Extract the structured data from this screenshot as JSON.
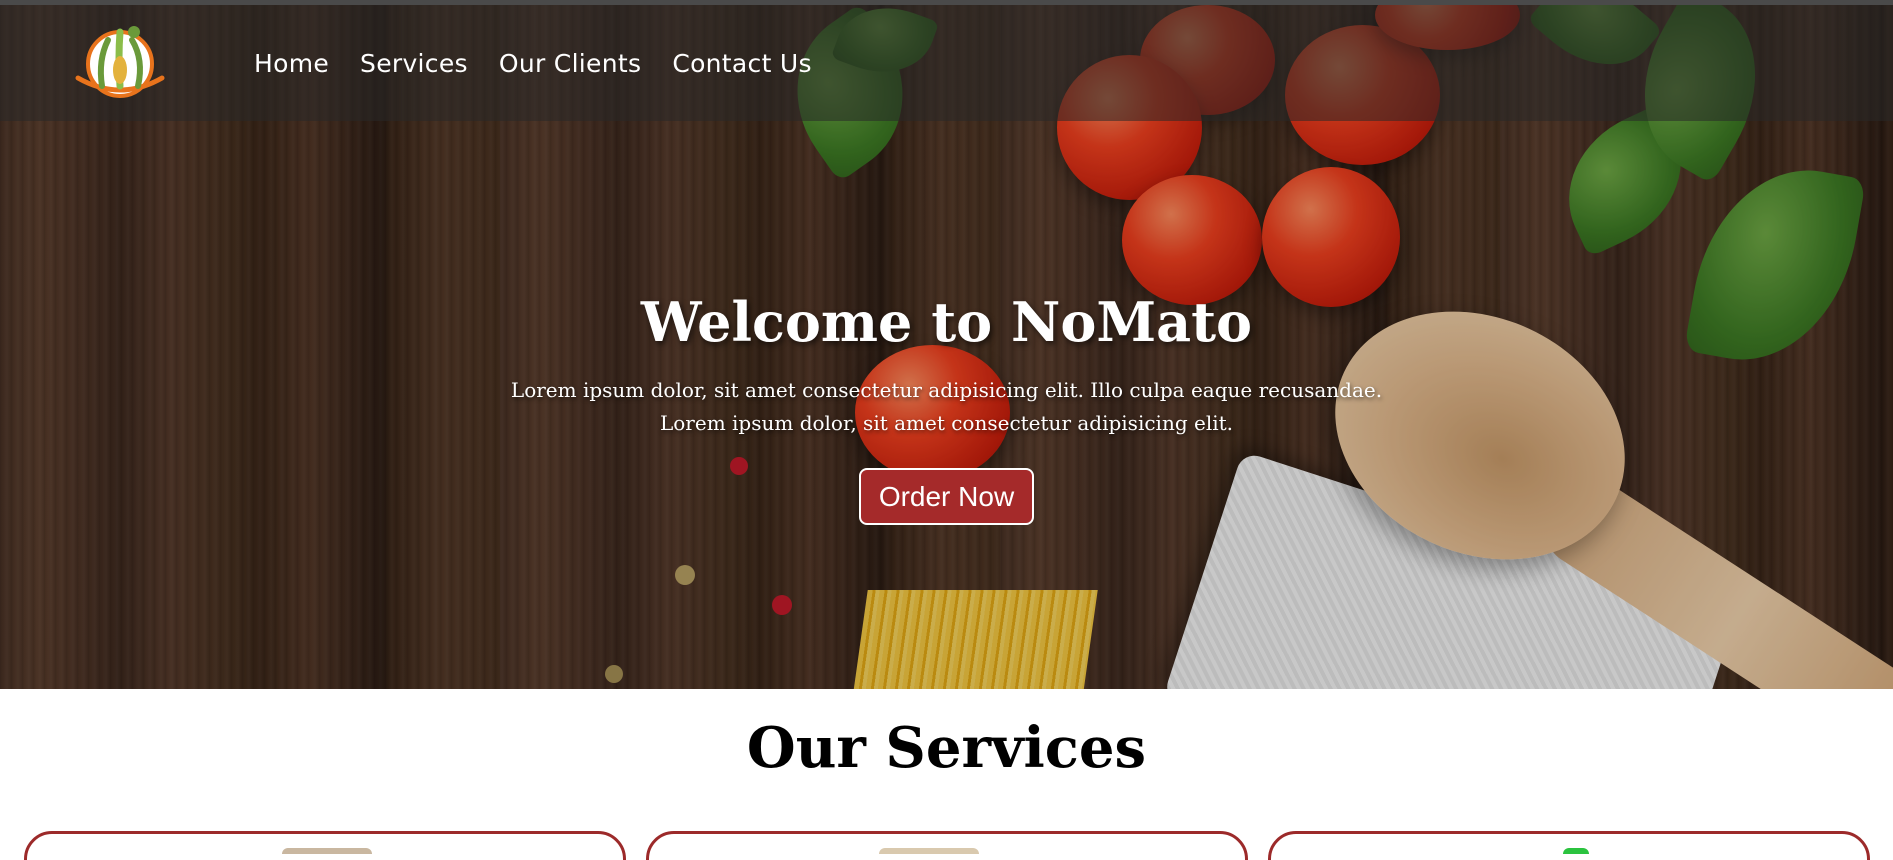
{
  "site": {
    "brand_icon": "restaurant-logo-icon",
    "accent_color": "#a52a2a"
  },
  "nav": {
    "items": [
      {
        "label": "Home"
      },
      {
        "label": "Services"
      },
      {
        "label": "Our Clients"
      },
      {
        "label": "Contact Us"
      }
    ]
  },
  "hero": {
    "title": "Welcome to NoMato",
    "text_line1": "Lorem ipsum dolor, sit amet consectetur adipisicing elit. Illo culpa eaque recusandae.",
    "text_line2": "Lorem ipsum dolor, sit amet consectetur adipisicing elit.",
    "cta_label": "Order Now"
  },
  "services": {
    "title": "Our Services",
    "card_border_color": "#9c2a2a"
  }
}
